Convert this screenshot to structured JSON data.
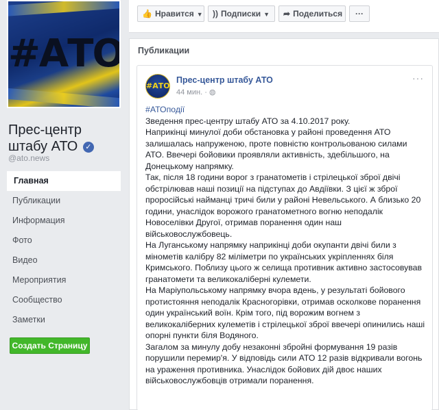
{
  "page": {
    "cover_logo_text": "#АТО",
    "name": "Прес-центр штабу АТО",
    "handle": "@ato.news",
    "verified_symbol": "✓"
  },
  "nav": {
    "items": [
      {
        "label": "Главная",
        "active": true
      },
      {
        "label": "Публикации"
      },
      {
        "label": "Информация"
      },
      {
        "label": "Фото"
      },
      {
        "label": "Видео"
      },
      {
        "label": "Мероприятия"
      },
      {
        "label": "Сообщество"
      },
      {
        "label": "Заметки"
      }
    ],
    "create_page_label": "Создать Страницу"
  },
  "actionbar": {
    "like_label": "Нравится",
    "follow_label": "Подписки",
    "share_label": "Поделиться",
    "more_label": "···"
  },
  "feed": {
    "title": "Публикации"
  },
  "post": {
    "avatar_text": "#АТО",
    "author": "Прес-центр штабу АТО",
    "time": "44 мин.",
    "more_label": "···",
    "hashtag": "#АТОподії",
    "paragraphs": [
      "Зведення прес-центру штабу АТО за 4.10.2017 року.",
      "Наприкінці минулої доби обстановка у районі проведення АТО залишалась напруженою, проте повністю контрольованою силами АТО. Ввечері бойовики проявляли активність, здебільшого, на Донецькому напрямку.",
      "Так, після 18 години ворог з гранатометів і стрілецької зброї двічі обстрілював наші позиції на підступах до Авдіївки. З цієї ж зброї проросійські найманці тричі били у районі Невельського. А близько 20 години, унаслідок ворожого гранатометного вогню неподалік Новоселівки Другої, отримав поранення один наш військовослужбовець.",
      "На Луганському напрямку наприкінці доби окупанти двічі били з мінометів калібру 82 міліметри по українських укріпленнях біля Кримського. Поблизу цього ж селища противник активно застосовував гранатомети та великокаліберні кулемети.",
      "На Маріупольському напрямку вчора вдень, у результаті бойового протистояння неподалік Красногорівки, отримав осколкове поранення один український воїн. Крім того, під ворожим вогнем з великокаліберних кулеметів і стрілецької зброї ввечері опинились наші опорні пункти біля Водяного.",
      "Загалом за минулу добу незаконні збройні формування 19 разів порушили перемир'я. У відповідь сили АТО 12 разів відкривали вогонь на ураження противника. Унаслідок бойових дій двоє наших військовослужбовців отримали поранення."
    ]
  },
  "colors": {
    "link": "#365899",
    "create_button": "#42b72a",
    "background": "#e9ebee"
  }
}
